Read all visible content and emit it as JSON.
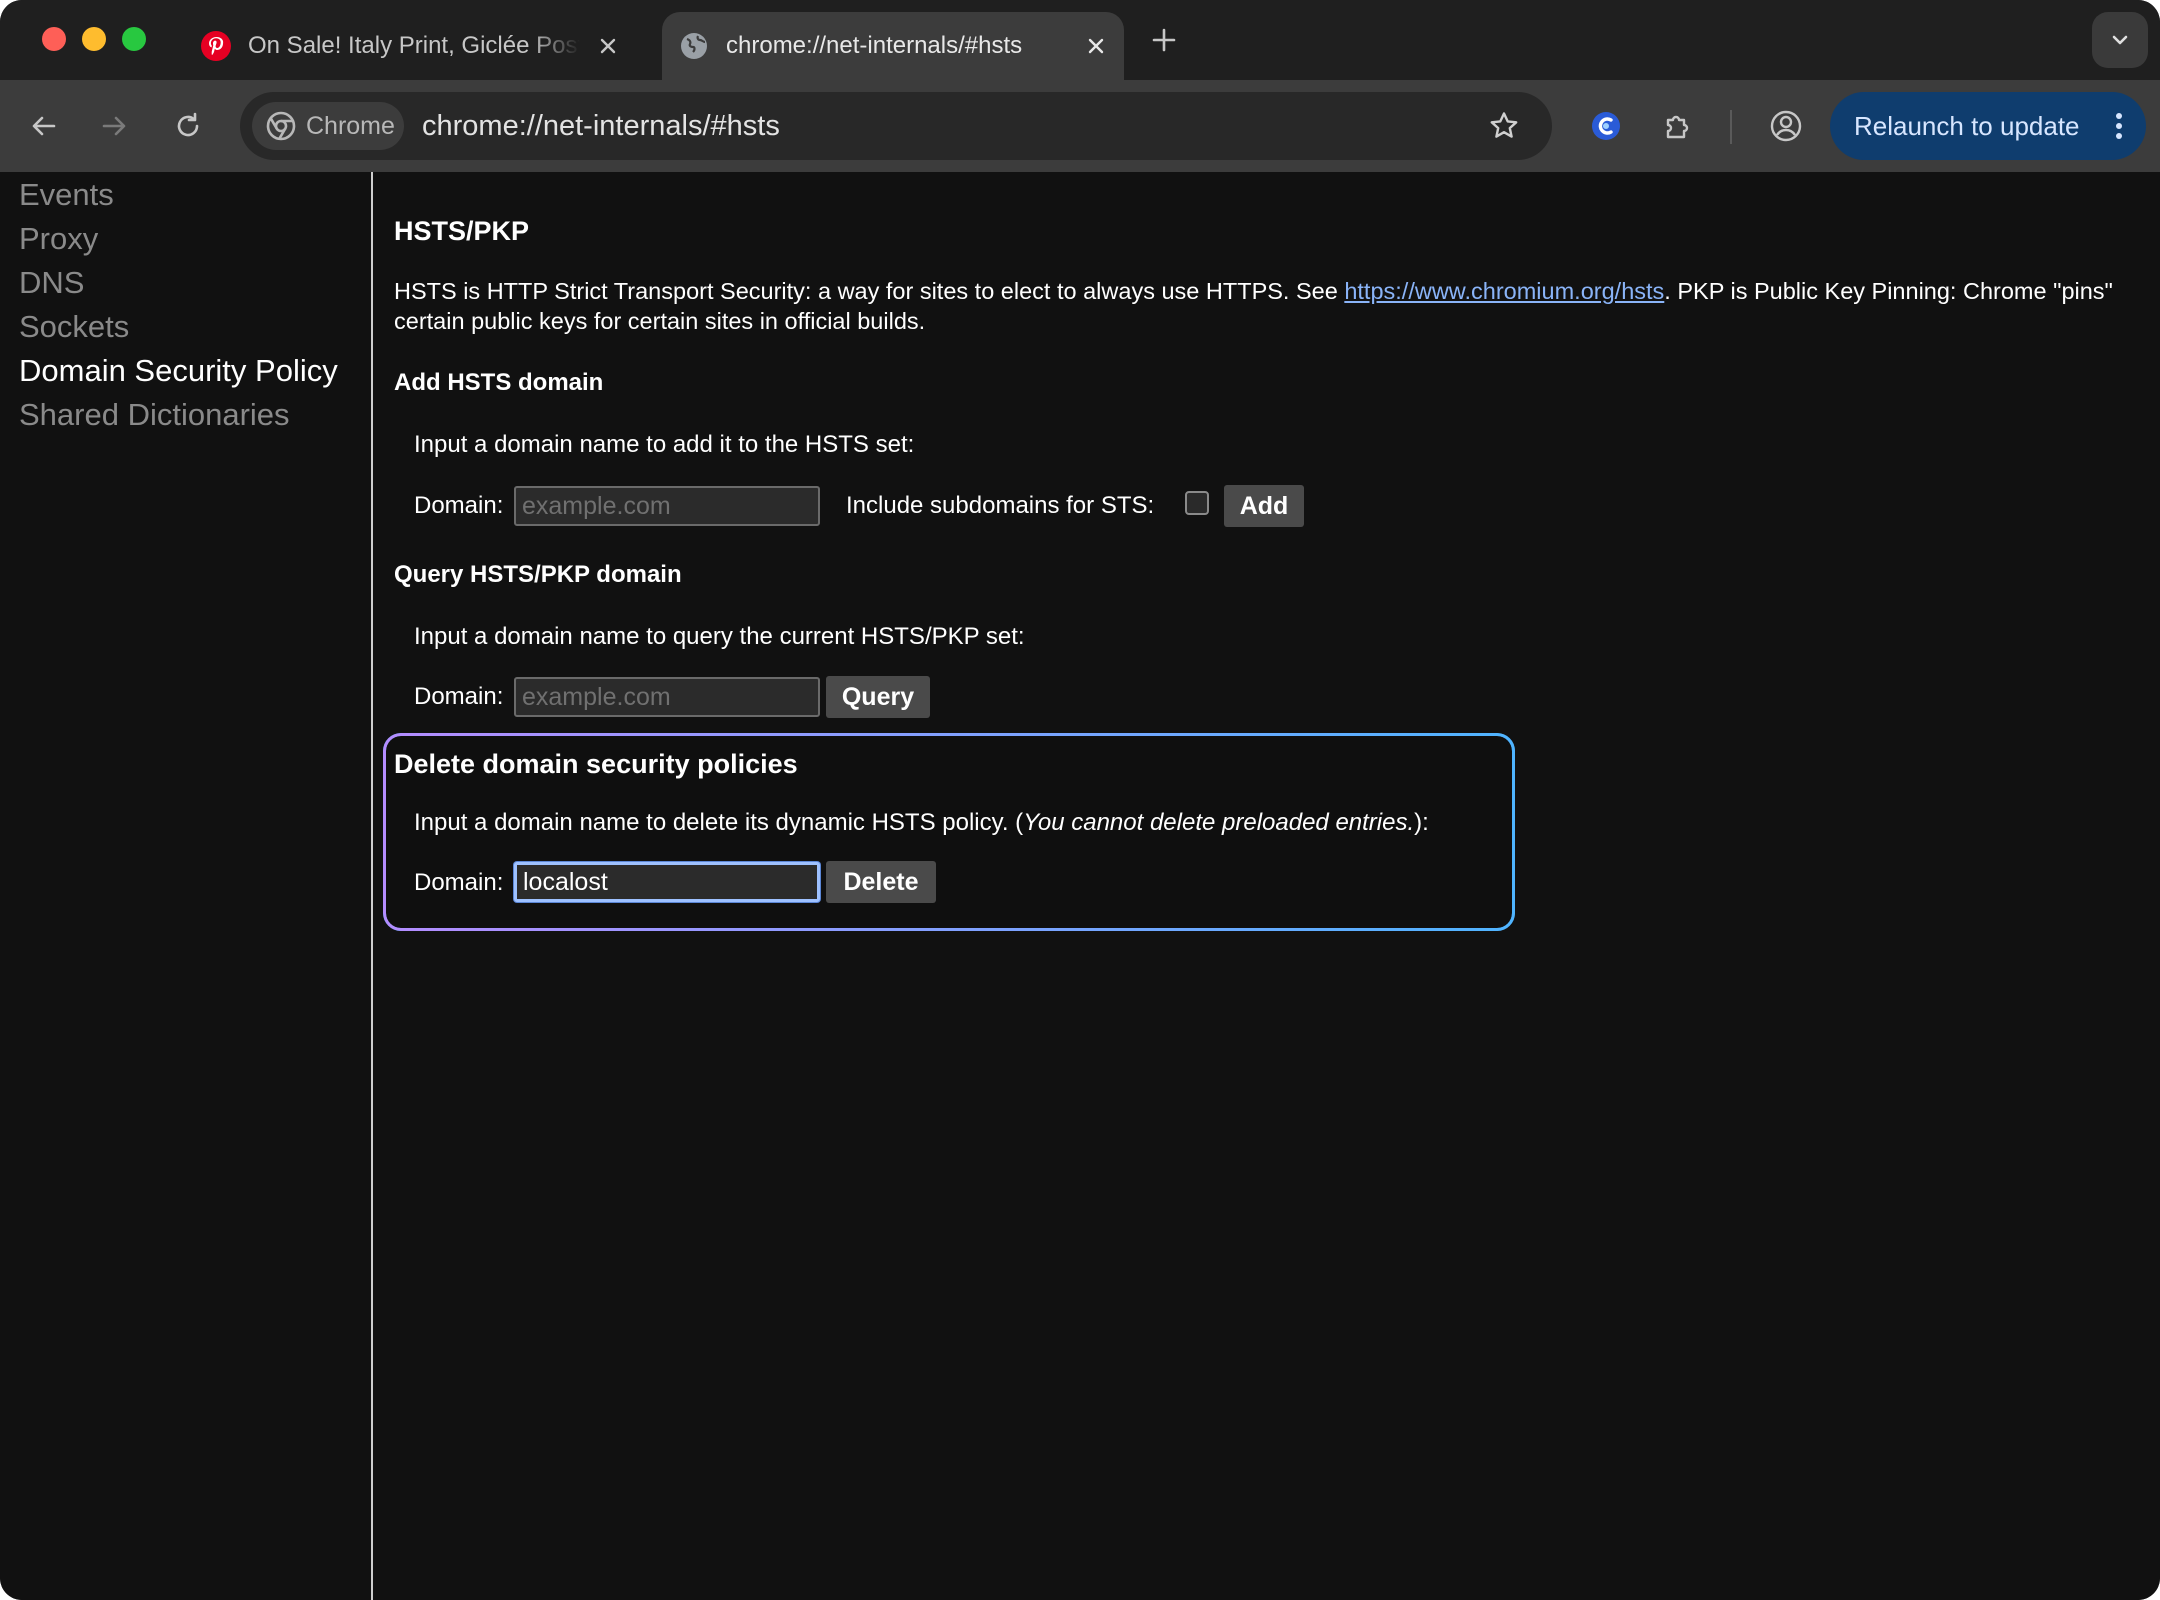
{
  "browser": {
    "tabs": [
      {
        "title": "On Sale! Italy Print, Giclée Poster",
        "icon": "pinterest-icon",
        "active": false
      },
      {
        "title": "chrome://net-internals/#hsts",
        "icon": "globe-icon",
        "active": true
      }
    ],
    "chip_label": "Chrome",
    "url": "chrome://net-internals/#hsts",
    "relaunch_label": "Relaunch to update",
    "colors": {
      "relaunch_bg": "#0f3d6e",
      "link": "#8ab4f8",
      "focus_ring": "#4fb4ff"
    }
  },
  "sidebar": {
    "items": [
      {
        "label": "Events",
        "selected": false
      },
      {
        "label": "Proxy",
        "selected": false
      },
      {
        "label": "DNS",
        "selected": false
      },
      {
        "label": "Sockets",
        "selected": false
      },
      {
        "label": "Domain Security Policy",
        "selected": true
      },
      {
        "label": "Shared Dictionaries",
        "selected": false
      }
    ]
  },
  "main": {
    "title": "HSTS/PKP",
    "intro_before_link": "HSTS is HTTP Strict Transport Security: a way for sites to elect to always use HTTPS. See ",
    "intro_link": "https://www.chromium.org/hsts",
    "intro_after_link": ". PKP is Public Key Pinning: Chrome \"pins\" certain public keys for certain sites in official builds.",
    "add": {
      "heading": "Add HSTS domain",
      "description": "Input a domain name to add it to the HSTS set:",
      "domain_label": "Domain:",
      "placeholder": "example.com",
      "subdomains_label": "Include subdomains for STS:",
      "button": "Add"
    },
    "query": {
      "heading": "Query HSTS/PKP domain",
      "description": "Input a domain name to query the current HSTS/PKP set:",
      "domain_label": "Domain:",
      "placeholder": "example.com",
      "button": "Query"
    },
    "delete": {
      "heading": "Delete domain security policies",
      "description_prefix": "Input a domain name to delete its dynamic HSTS policy. (",
      "description_italic": "You cannot delete preloaded entries.",
      "description_suffix": "):",
      "domain_label": "Domain:",
      "value": "localost",
      "button": "Delete"
    }
  }
}
